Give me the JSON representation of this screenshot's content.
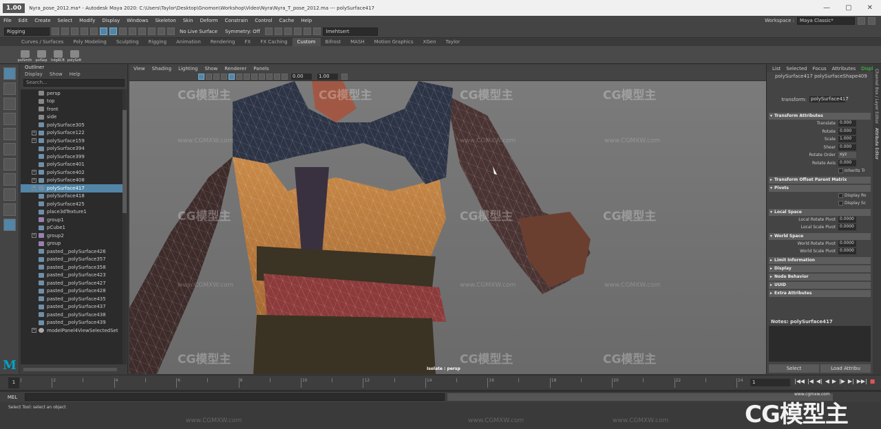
{
  "app": {
    "version_badge": "1.00",
    "window_title": "Nyra_pose_2012.ma* - Autodesk Maya 2020: C:\\Users\\Taylor\\Desktop\\Gnomon\\Workshop\\Video\\Nyra\\Nyra_T_pose_2012.ma --- polySurface417",
    "window_controls": [
      "—",
      "▢",
      "✕"
    ]
  },
  "menubar": {
    "items": [
      "File",
      "Edit",
      "Create",
      "Select",
      "Modify",
      "Display",
      "Windows",
      "Skeleton",
      "Skin",
      "Deform",
      "Constrain",
      "Control",
      "Cache",
      "Help"
    ],
    "workspace_label": "Workspace :",
    "workspace_value": "Maya Classic*"
  },
  "statusline": {
    "mode": "Rigging",
    "live_surface": "No Live Surface",
    "symmetry": "Symmetry: Off",
    "user": "lmehtsert"
  },
  "shelf": {
    "tabs": [
      "Curves / Surfaces",
      "Poly Modeling",
      "Sculpting",
      "Rigging",
      "Animation",
      "Rendering",
      "FX",
      "FX Caching",
      "Custom",
      "Bifrost",
      "MASH",
      "Motion Graphics",
      "XGen",
      "Taylor"
    ],
    "active_tab": "Custom",
    "buttons": [
      "polSmth",
      "polSep",
      "hdgRCB",
      "polySoft"
    ]
  },
  "outliner": {
    "title": "Outliner",
    "menu": [
      "Display",
      "Show",
      "Help"
    ],
    "search_placeholder": "Search...",
    "items": [
      {
        "label": "persp",
        "type": "cam",
        "expand": false
      },
      {
        "label": "top",
        "type": "cam",
        "expand": false
      },
      {
        "label": "front",
        "type": "cam",
        "expand": false
      },
      {
        "label": "side",
        "type": "cam",
        "expand": false
      },
      {
        "label": "polySurface305",
        "type": "mesh",
        "expand": false
      },
      {
        "label": "polySurface122",
        "type": "mesh",
        "expand": true
      },
      {
        "label": "polySurface159",
        "type": "mesh",
        "expand": true
      },
      {
        "label": "polySurface394",
        "type": "mesh",
        "expand": false
      },
      {
        "label": "polySurface399",
        "type": "mesh",
        "expand": false
      },
      {
        "label": "polySurface401",
        "type": "mesh",
        "expand": false
      },
      {
        "label": "polySurface402",
        "type": "mesh",
        "expand": true
      },
      {
        "label": "polySurface408",
        "type": "mesh",
        "expand": true
      },
      {
        "label": "polySurface417",
        "type": "mesh",
        "expand": true,
        "selected": true
      },
      {
        "label": "polySurface418",
        "type": "mesh",
        "expand": false
      },
      {
        "label": "polySurface425",
        "type": "mesh",
        "expand": false
      },
      {
        "label": "place3dTexture1",
        "type": "mesh",
        "expand": false
      },
      {
        "label": "group1",
        "type": "grp",
        "expand": false
      },
      {
        "label": "pCube1",
        "type": "mesh",
        "expand": false
      },
      {
        "label": "group2",
        "type": "grp",
        "expand": true
      },
      {
        "label": "group",
        "type": "grp",
        "expand": false
      },
      {
        "label": "pasted__polySurface426",
        "type": "mesh",
        "expand": false
      },
      {
        "label": "pasted__polySurface357",
        "type": "mesh",
        "expand": false
      },
      {
        "label": "pasted__polySurface358",
        "type": "mesh",
        "expand": false
      },
      {
        "label": "pasted__polySurface423",
        "type": "mesh",
        "expand": false
      },
      {
        "label": "pasted__polySurface427",
        "type": "mesh",
        "expand": false
      },
      {
        "label": "pasted__polySurface428",
        "type": "mesh",
        "expand": false
      },
      {
        "label": "pasted__polySurface435",
        "type": "mesh",
        "expand": false
      },
      {
        "label": "pasted__polySurface437",
        "type": "mesh",
        "expand": false
      },
      {
        "label": "pasted__polySurface438",
        "type": "mesh",
        "expand": false
      },
      {
        "label": "pasted__polySurface439",
        "type": "mesh",
        "expand": false
      },
      {
        "label": "modelPanel4ViewSelectedSet",
        "type": "set",
        "expand": true
      }
    ]
  },
  "viewport": {
    "menu": [
      "View",
      "Shading",
      "Lighting",
      "Show",
      "Renderer",
      "Panels"
    ],
    "field_a": "0.00",
    "field_b": "1.00",
    "label": "Isolate : persp"
  },
  "attribute_editor": {
    "menu": [
      "List",
      "Selected",
      "Focus",
      "Attributes",
      "Display"
    ],
    "tabs": "polySurface417   polySurfaceShape409",
    "transform_label": "transform:",
    "transform_value": "polySurface417",
    "sections": [
      {
        "title": "Transform Attributes",
        "open": true
      },
      {
        "title": "Transform Offset Parent Matrix",
        "open": false
      },
      {
        "title": "Pivots",
        "open": true
      },
      {
        "title": "Local Space",
        "open": true
      },
      {
        "title": "World Space",
        "open": true
      },
      {
        "title": "Limit Information",
        "open": false
      },
      {
        "title": "Display",
        "open": false
      },
      {
        "title": "Node Behavior",
        "open": false
      },
      {
        "title": "UUID",
        "open": false
      },
      {
        "title": "Extra Attributes",
        "open": false
      }
    ],
    "transform_rows": [
      {
        "label": "Translate",
        "value": "0.000"
      },
      {
        "label": "Rotate",
        "value": "0.000"
      },
      {
        "label": "Scale",
        "value": "1.000"
      },
      {
        "label": "Shear",
        "value": "0.000"
      },
      {
        "label": "Rotate Order",
        "value": "xyz"
      },
      {
        "label": "Rotate Axis",
        "value": "0.000"
      }
    ],
    "inherits": "Inherits Tr",
    "pivot_checks": [
      "Display Ro",
      "Display Sc"
    ],
    "local_rows": [
      {
        "label": "Local Rotate Pivot",
        "value": "0.0000"
      },
      {
        "label": "Local Scale Pivot",
        "value": "0.0000"
      }
    ],
    "world_rows": [
      {
        "label": "World Rotate Pivot",
        "value": "0.0000"
      },
      {
        "label": "World Scale Pivot",
        "value": "0.0000"
      }
    ],
    "notes": "Notes:  polySurface417",
    "buttons": [
      "Select",
      "Load Attribu"
    ],
    "side_tabs": [
      "Channel Box / Layer Editor",
      "Attribute Editor"
    ]
  },
  "timeslider": {
    "current_frame": "1",
    "ticks": [
      "2",
      "4",
      "6",
      "8",
      "10",
      "12",
      "14",
      "16",
      "18",
      "20",
      "22",
      "24"
    ],
    "end_field": "1",
    "playback": [
      "|◀◀",
      "|◀",
      "◀|",
      "◀",
      "▶",
      "|▶",
      "▶|",
      "▶▶|",
      "■"
    ]
  },
  "cmdline": {
    "mel": "MEL"
  },
  "helpline": {
    "text": "Select Tool: select an object"
  },
  "watermark": {
    "brand": "CG模型主",
    "url": "www.CGMXW.com",
    "url_small": "www.cgmxw.com"
  },
  "colors": {
    "accent": "#5285a6",
    "maya_logo": "#00a3c7",
    "record": "#e05454"
  }
}
